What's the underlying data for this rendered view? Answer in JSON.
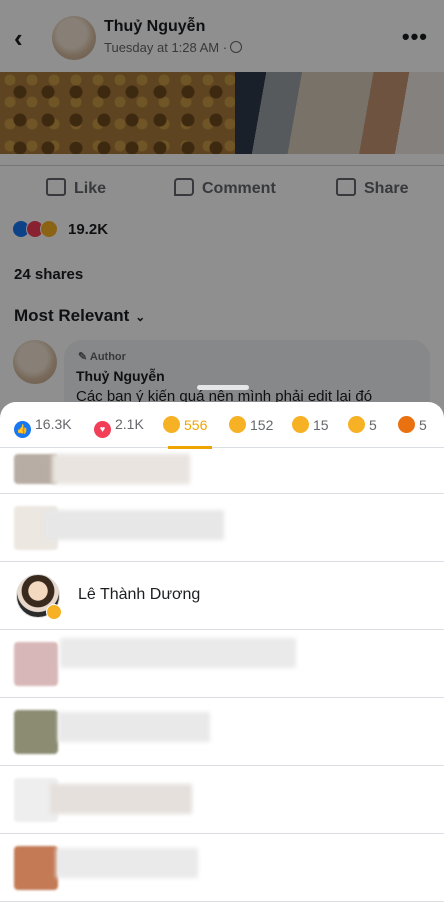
{
  "post": {
    "author": "Thuỷ Nguyễn",
    "timestamp": "Tuesday at 1:28 AM ·",
    "actions": {
      "like": "Like",
      "comment": "Comment",
      "share": "Share"
    },
    "reaction_total": "19.2K",
    "shares": "24 shares",
    "sort_label": "Most Relevant"
  },
  "comment": {
    "tag": "Author",
    "author": "Thuỷ Nguyễn",
    "text": "Các bạn ý kiến quá nên mình phải edit lại đó"
  },
  "reactions_sheet": {
    "tabs": [
      {
        "emoji": "like",
        "count": "16.3K"
      },
      {
        "emoji": "love",
        "count": "2.1K"
      },
      {
        "emoji": "care",
        "count": "556",
        "active": true
      },
      {
        "emoji": "haha",
        "count": "152"
      },
      {
        "emoji": "wow",
        "count": "15"
      },
      {
        "emoji": "sad",
        "count": "5"
      },
      {
        "emoji": "angry",
        "count": "5"
      }
    ],
    "visible_person": {
      "name": "Lê Thành Dương",
      "reaction": "care"
    }
  },
  "colors": {
    "like_blue": "#1877f2",
    "love_red": "#f33e58",
    "care_yellow": "#f7b125",
    "active_tab": "#f0a400",
    "angry_orange": "#e9710f"
  },
  "icons": [
    "back-arrow-icon",
    "globe-icon",
    "more-icon",
    "like-icon",
    "comment-icon",
    "share-icon",
    "sort-chevron-icon",
    "pencil-icon"
  ]
}
